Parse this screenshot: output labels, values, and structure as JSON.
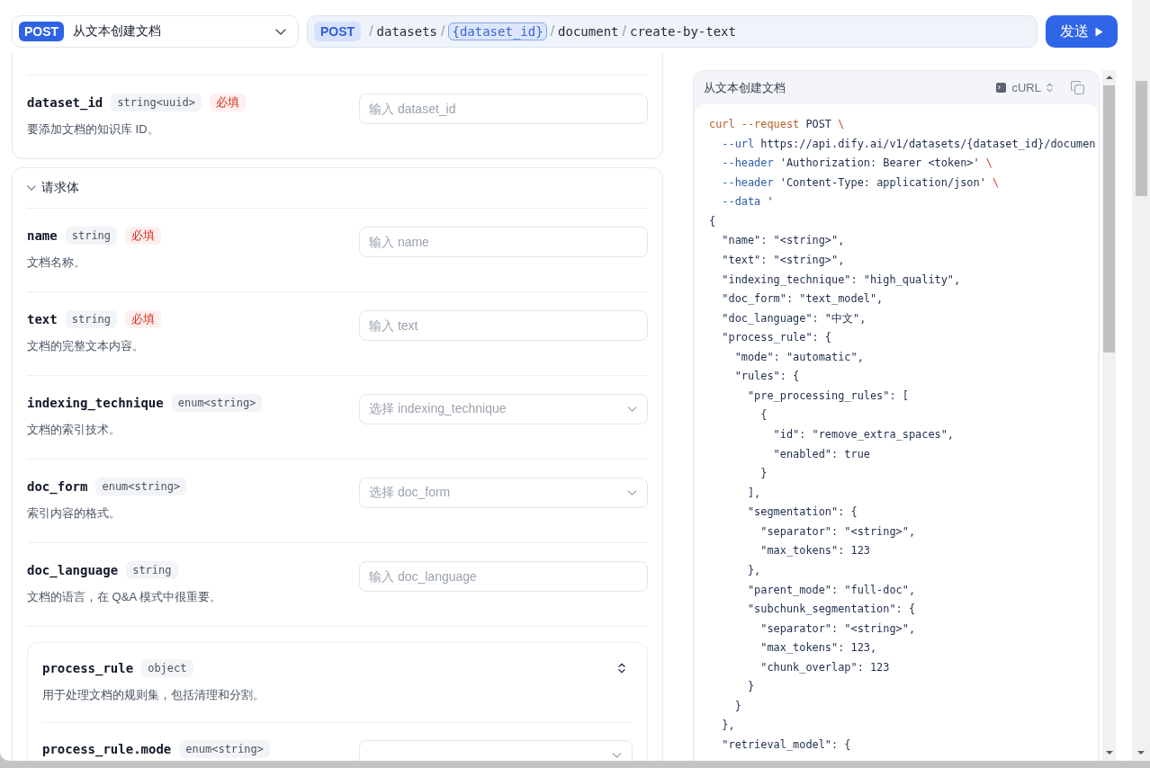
{
  "request_bar": {
    "method_select": {
      "method": "POST",
      "label": "从文本创建文档"
    },
    "url": {
      "method": "POST",
      "segments": [
        {
          "separator": "/",
          "text": "datasets",
          "kind": "static"
        },
        {
          "separator": "/",
          "text": "{dataset_id}",
          "kind": "param"
        },
        {
          "separator": "/",
          "text": "document",
          "kind": "static"
        },
        {
          "separator": "/",
          "text": "create-by-text",
          "kind": "static"
        }
      ]
    },
    "send_button": {
      "label": "发送"
    }
  },
  "path_section": {
    "fields": [
      {
        "name": "dataset_id",
        "type": "string<uuid>",
        "required_badge": "必填",
        "description": "要添加文档的知识库 ID。",
        "control": {
          "kind": "input",
          "placeholder": "输入 dataset_id"
        }
      }
    ]
  },
  "body_section": {
    "title": "请求体",
    "expanded": true,
    "fields": [
      {
        "kind": "field",
        "name": "name",
        "type": "string",
        "required_badge": "必填",
        "description": "文档名称。",
        "control": {
          "kind": "input",
          "placeholder": "输入 name"
        }
      },
      {
        "kind": "field",
        "name": "text",
        "type": "string",
        "required_badge": "必填",
        "description": "文档的完整文本内容。",
        "control": {
          "kind": "input",
          "placeholder": "输入 text"
        }
      },
      {
        "kind": "field",
        "name": "indexing_technique",
        "type": "enum<string>",
        "description": "文档的索引技术。",
        "control": {
          "kind": "select",
          "placeholder": "选择 indexing_technique"
        }
      },
      {
        "kind": "field",
        "name": "doc_form",
        "type": "enum<string>",
        "description": "索引内容的格式。",
        "control": {
          "kind": "select",
          "placeholder": "选择 doc_form"
        }
      },
      {
        "kind": "field",
        "name": "doc_language",
        "type": "string",
        "description": "文档的语言，在 Q&A 模式中很重要。",
        "control": {
          "kind": "input",
          "placeholder": "输入 doc_language"
        }
      },
      {
        "kind": "object",
        "name": "process_rule",
        "type": "object",
        "description": "用于处理文档的规则集，包括清理和分割。",
        "children": [
          {
            "kind": "field",
            "name": "process_rule.mode",
            "type": "enum<string>",
            "control": {
              "kind": "select"
            }
          }
        ]
      }
    ]
  },
  "code_panel": {
    "title": "从文本创建文档",
    "language": "cURL",
    "lines": [
      [
        {
          "kind": "command",
          "text": "curl --request"
        },
        {
          "kind": "text",
          "text": " POST "
        },
        {
          "kind": "escape",
          "text": "\\"
        }
      ],
      [
        {
          "kind": "flag",
          "text": "  --url"
        },
        {
          "kind": "text",
          "text": " https://api.dify.ai/v1/datasets/{dataset_id}/documen"
        }
      ],
      [
        {
          "kind": "flag",
          "text": "  --header"
        },
        {
          "kind": "text",
          "text": " 'Authorization: Bearer <token>' "
        },
        {
          "kind": "escape",
          "text": "\\"
        }
      ],
      [
        {
          "kind": "flag",
          "text": "  --header"
        },
        {
          "kind": "text",
          "text": " 'Content-Type: application/json' "
        },
        {
          "kind": "escape",
          "text": "\\"
        }
      ],
      [
        {
          "kind": "flag",
          "text": "  --data"
        },
        {
          "kind": "text",
          "text": " '"
        }
      ],
      [
        {
          "kind": "text",
          "text": "{"
        }
      ],
      [
        {
          "kind": "text",
          "text": "  \"name\": \"<string>\","
        }
      ],
      [
        {
          "kind": "text",
          "text": "  \"text\": \"<string>\","
        }
      ],
      [
        {
          "kind": "text",
          "text": "  \"indexing_technique\": \"high_quality\","
        }
      ],
      [
        {
          "kind": "text",
          "text": "  \"doc_form\": \"text_model\","
        }
      ],
      [
        {
          "kind": "text",
          "text": "  \"doc_language\": \"中文\","
        }
      ],
      [
        {
          "kind": "text",
          "text": "  \"process_rule\": {"
        }
      ],
      [
        {
          "kind": "text",
          "text": "    \"mode\": \"automatic\","
        }
      ],
      [
        {
          "kind": "text",
          "text": "    \"rules\": {"
        }
      ],
      [
        {
          "kind": "text",
          "text": "      \"pre_processing_rules\": ["
        }
      ],
      [
        {
          "kind": "text",
          "text": "        {"
        }
      ],
      [
        {
          "kind": "text",
          "text": "          \"id\": \"remove_extra_spaces\","
        }
      ],
      [
        {
          "kind": "text",
          "text": "          \"enabled\": true"
        }
      ],
      [
        {
          "kind": "text",
          "text": "        }"
        }
      ],
      [
        {
          "kind": "text",
          "text": "      ],"
        }
      ],
      [
        {
          "kind": "text",
          "text": "      \"segmentation\": {"
        }
      ],
      [
        {
          "kind": "text",
          "text": "        \"separator\": \"<string>\","
        }
      ],
      [
        {
          "kind": "text",
          "text": "        \"max_tokens\": 123"
        }
      ],
      [
        {
          "kind": "text",
          "text": "      },"
        }
      ],
      [
        {
          "kind": "text",
          "text": "      \"parent_mode\": \"full-doc\","
        }
      ],
      [
        {
          "kind": "text",
          "text": "      \"subchunk_segmentation\": {"
        }
      ],
      [
        {
          "kind": "text",
          "text": "        \"separator\": \"<string>\","
        }
      ],
      [
        {
          "kind": "text",
          "text": "        \"max_tokens\": 123,"
        }
      ],
      [
        {
          "kind": "text",
          "text": "        \"chunk_overlap\": 123"
        }
      ],
      [
        {
          "kind": "text",
          "text": "      }"
        }
      ],
      [
        {
          "kind": "text",
          "text": "    }"
        }
      ],
      [
        {
          "kind": "text",
          "text": "  },"
        }
      ],
      [
        {
          "kind": "text",
          "text": "  \"retrieval_model\": {"
        }
      ]
    ]
  }
}
